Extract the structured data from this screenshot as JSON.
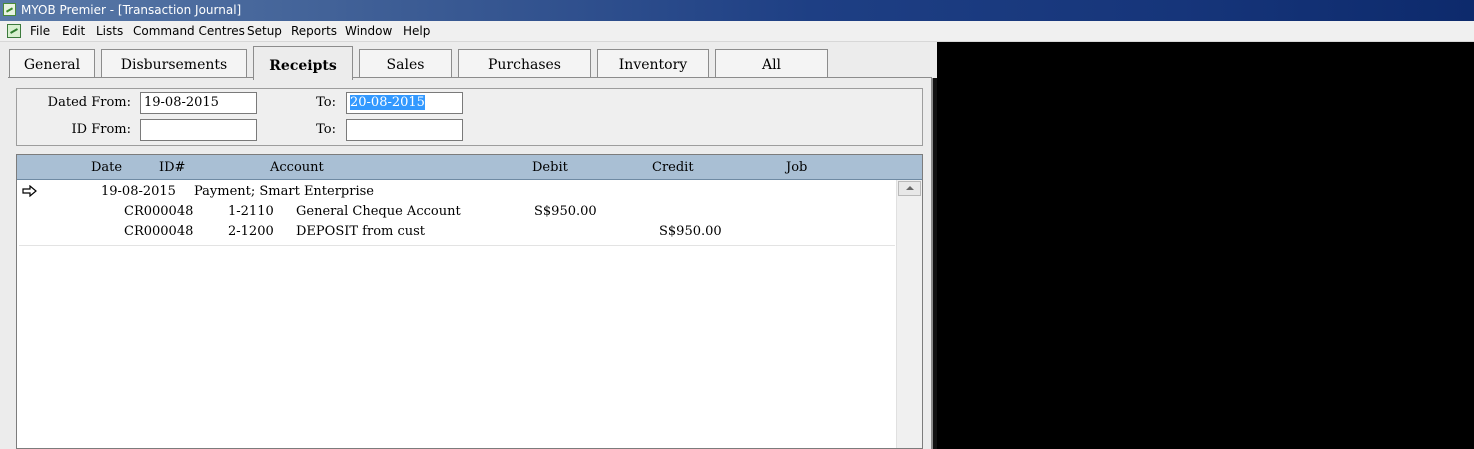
{
  "titlebar": {
    "title": "MYOB Premier - [Transaction Journal]"
  },
  "menu": [
    "File",
    "Edit",
    "Lists",
    "Command Centres",
    "Setup",
    "Reports",
    "Window",
    "Help"
  ],
  "tabs": {
    "general": "General",
    "disbursements": "Disbursements",
    "receipts": "Receipts",
    "sales": "Sales",
    "purchases": "Purchases",
    "inventory": "Inventory",
    "all": "All"
  },
  "filters": {
    "dated_from_label": "Dated From:",
    "dated_from_value": "19-08-2015",
    "dated_to_label": "To:",
    "dated_to_value": "20-08-2015",
    "id_from_label": "ID From:",
    "id_from_value": "",
    "id_to_label": "To:",
    "id_to_value": ""
  },
  "columns": {
    "date": "Date",
    "id": "ID#",
    "account": "Account",
    "debit": "Debit",
    "credit": "Credit",
    "job": "Job"
  },
  "journal": {
    "entry_date": "19-08-2015",
    "entry_memo": "Payment; Smart Enterprise",
    "lines": [
      {
        "id": "CR000048",
        "account_no": "1-2110",
        "account_name": "General Cheque Account",
        "debit": "S$950.00",
        "credit": ""
      },
      {
        "id": "CR000048",
        "account_no": "2-1200",
        "account_name": "DEPOSIT from cust",
        "debit": "",
        "credit": "S$950.00"
      }
    ]
  },
  "icons": {
    "app": "myob-app-icon",
    "row_pointer": "arrow-right-icon",
    "scroll_up": "scroll-up-arrow-icon"
  },
  "colors": {
    "header_bg": "#a9bfd4",
    "selection": "#3399ff",
    "titlebar": "#1e3f84"
  }
}
